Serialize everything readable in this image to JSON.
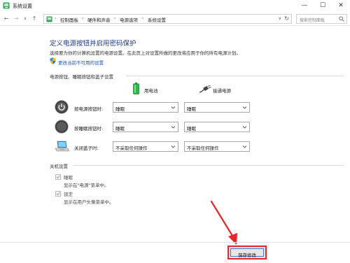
{
  "window": {
    "title": "系统设置",
    "minimize_glyph": "—",
    "maximize_glyph": "☐",
    "close_glyph": "✕",
    "app_icon": "control-panel-icon"
  },
  "addressbar": {
    "back_glyph": "←",
    "forward_glyph": "→",
    "recent_glyph": "∨",
    "up_glyph": "↑",
    "breadcrumbs": [
      "控制面板",
      "硬件和声音",
      "电源选项",
      "系统设置"
    ],
    "separator": "›",
    "history_glyph": "∨",
    "refresh_glyph": "↻",
    "search_placeholder": "搜索控制面板"
  },
  "main": {
    "title": "定义电源按钮并启用密码保护",
    "description": "选择要为你的计算机设置的电源设置。在此页上对设置所做的更改将应用于你的所有电源计划。",
    "change_link": "更改当前不可用的设置"
  },
  "power_buttons": {
    "section_label": "电源按钮、睡眠按钮和盖子设置",
    "columns": [
      {
        "label": "用电池",
        "icon": "battery-icon"
      },
      {
        "label": "接通电源",
        "icon": "plug-icon"
      }
    ],
    "rows": [
      {
        "label": "按电源按钮时:",
        "icon": "power-icon",
        "battery": "睡眠",
        "plugged": "睡眠"
      },
      {
        "label": "按睡眠按钮时:",
        "icon": "sleep-moon-icon",
        "battery": "睡眠",
        "plugged": "睡眠"
      },
      {
        "label": "关闭盖子时:",
        "icon": "laptop-lid-icon",
        "battery": "不采取任何操作",
        "plugged": "不采取任何操作"
      }
    ]
  },
  "shutdown": {
    "section_label": "关机设置",
    "options": [
      {
        "label": "睡眠",
        "description": "显示在\"电源\"菜单中。",
        "checked": true
      },
      {
        "label": "锁定",
        "description": "显示在用户头像菜单中。",
        "checked": true
      }
    ]
  },
  "footer": {
    "save_label": "保存修改"
  },
  "colors": {
    "title_blue": "#1e3a8a",
    "link_blue": "#1a56c6",
    "annotation_red": "#e8262a",
    "battery_green": "#2fb84a"
  }
}
